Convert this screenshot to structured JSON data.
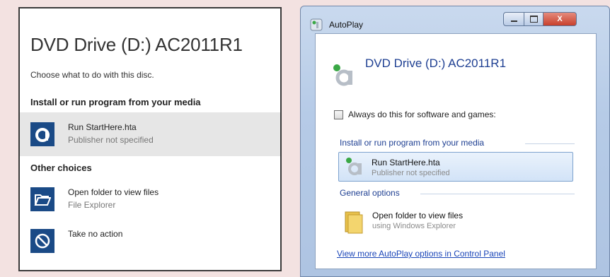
{
  "win10": {
    "title": "DVD Drive (D:) AC2011R1",
    "subtitle": "Choose what to do with this disc.",
    "section1": "Install or run program from your media",
    "run_label": "Run StartHere.hta",
    "run_sub": "Publisher not specified",
    "section2": "Other choices",
    "open_label": "Open folder to view files",
    "open_sub": "File Explorer",
    "noaction_label": "Take no action"
  },
  "win7": {
    "window_title": "AutoPlay",
    "title": "DVD Drive (D:) AC2011R1",
    "checkbox_label": "Always do this for software and games:",
    "group1": "Install or run program from your media",
    "run_label": "Run StartHere.hta",
    "run_sub": "Publisher not specified",
    "group2": "General options",
    "open_label": "Open folder to view files",
    "open_sub": "using Windows Explorer",
    "link": "View more AutoPlay options in Control Panel",
    "close_glyph": "X"
  },
  "colors": {
    "win10_tile": "#1a4a86",
    "win7_heading": "#1e3f92",
    "win7_link": "#1a45b8",
    "selection_gray": "#e6e6e6"
  },
  "icons": [
    "app-icon",
    "folder-icon",
    "no-action-icon",
    "autoplay-icon",
    "window-close-icon"
  ]
}
